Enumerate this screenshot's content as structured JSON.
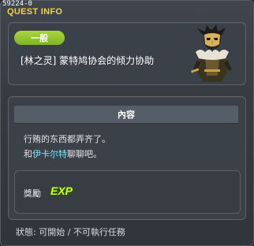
{
  "window": {
    "quest_id": "59224-0",
    "title": "QUEST INFO"
  },
  "quest": {
    "category": "一般",
    "name": "[林之灵] 蒙特鸠协会的倾力协助",
    "npc_portrait": "masked-villain-portrait"
  },
  "content": {
    "header": "內容",
    "line1": "行贿的东西都弄齐了。",
    "line2_prefix": "和",
    "line2_npc": "伊卡尔特",
    "line2_suffix": "聊聊吧。",
    "npc_link_color": "#7fe3ff"
  },
  "reward": {
    "label": "獎勵",
    "icon": "exp-icon",
    "icon_text": "EXP"
  },
  "status": {
    "text": "狀態: 可開始 / 不可執行任務"
  },
  "colors": {
    "title": "#f2d33a",
    "badge": "#8fc42e",
    "exp": "#c7ff22"
  }
}
